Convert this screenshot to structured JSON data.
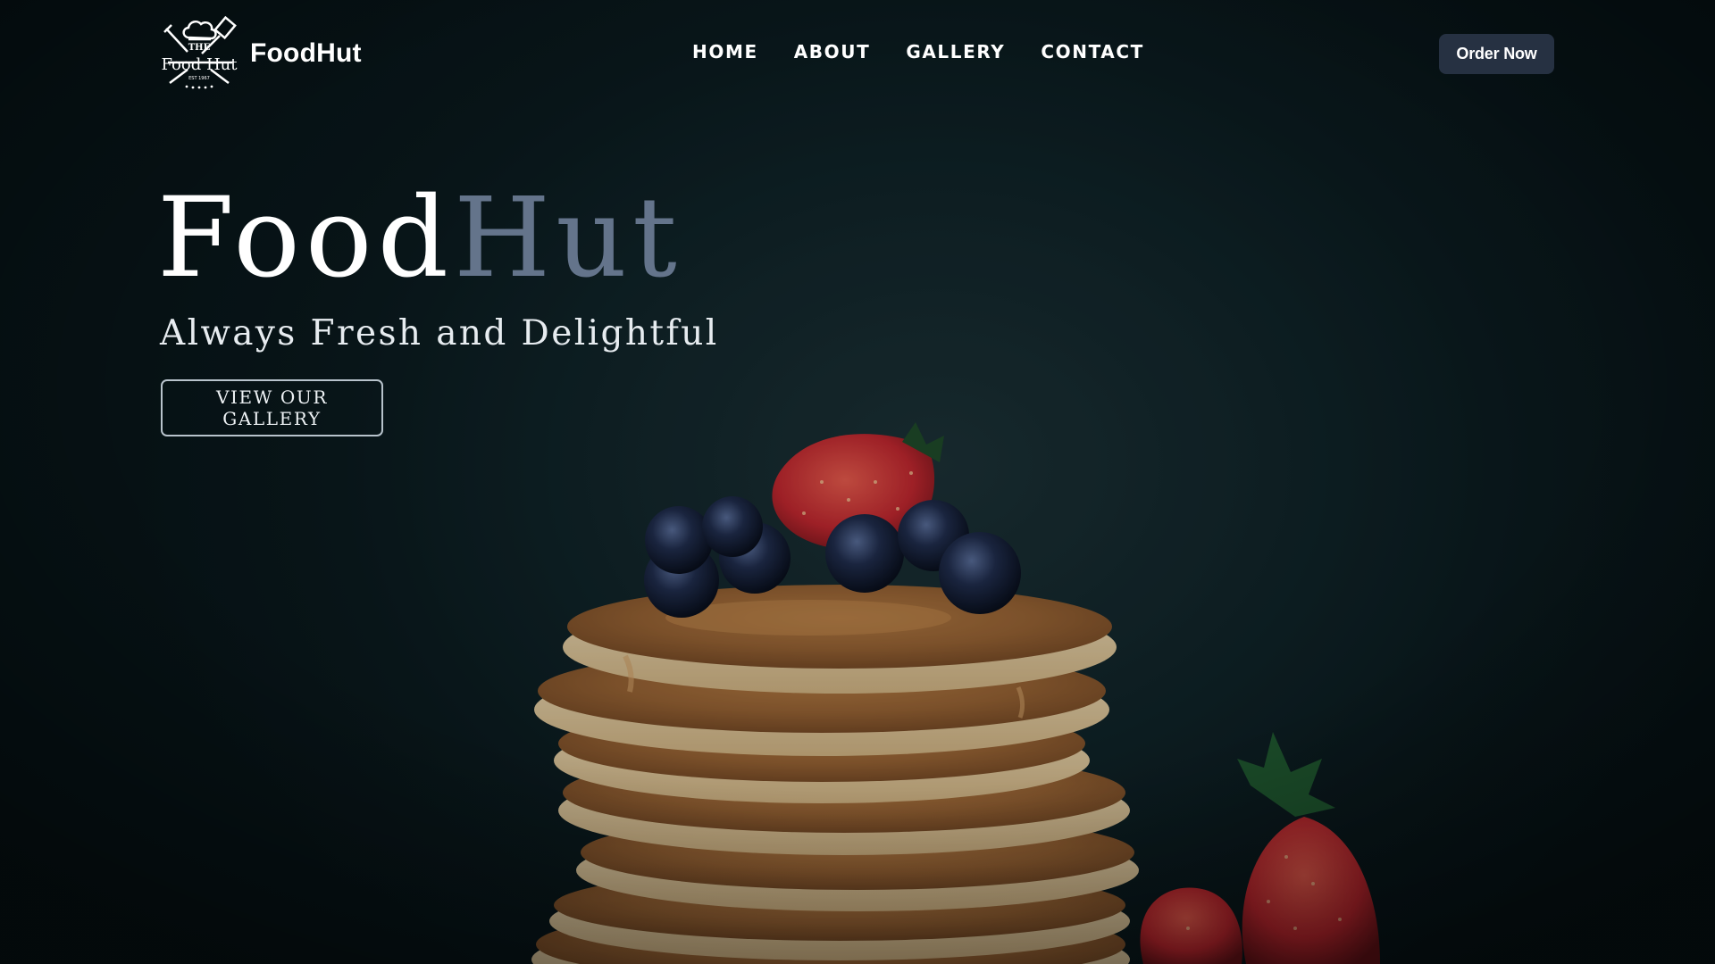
{
  "header": {
    "brand_name": "FoodHut",
    "logo_text_top": "THE",
    "logo_text_main": "Food Hut",
    "logo_text_small": "EST 1967",
    "nav": [
      {
        "label": "HOME"
      },
      {
        "label": "ABOUT"
      },
      {
        "label": "GALLERY"
      },
      {
        "label": "CONTACT"
      }
    ],
    "cta_label": "Order Now"
  },
  "hero": {
    "title_part_a": "Food",
    "title_part_b": "Hut",
    "subtitle": "Always Fresh and Delightful",
    "button_label": "VIEW OUR GALLERY"
  },
  "colors": {
    "background": "#0b1b1e",
    "title_accent": "#64748b",
    "cta_background": "#263142",
    "pancake": "#c98a4a",
    "strawberry": "#c8242b",
    "blueberry": "#1a2340"
  },
  "image": {
    "subject": "stack of pancakes topped with strawberry and blueberries, with strawberries at right"
  }
}
